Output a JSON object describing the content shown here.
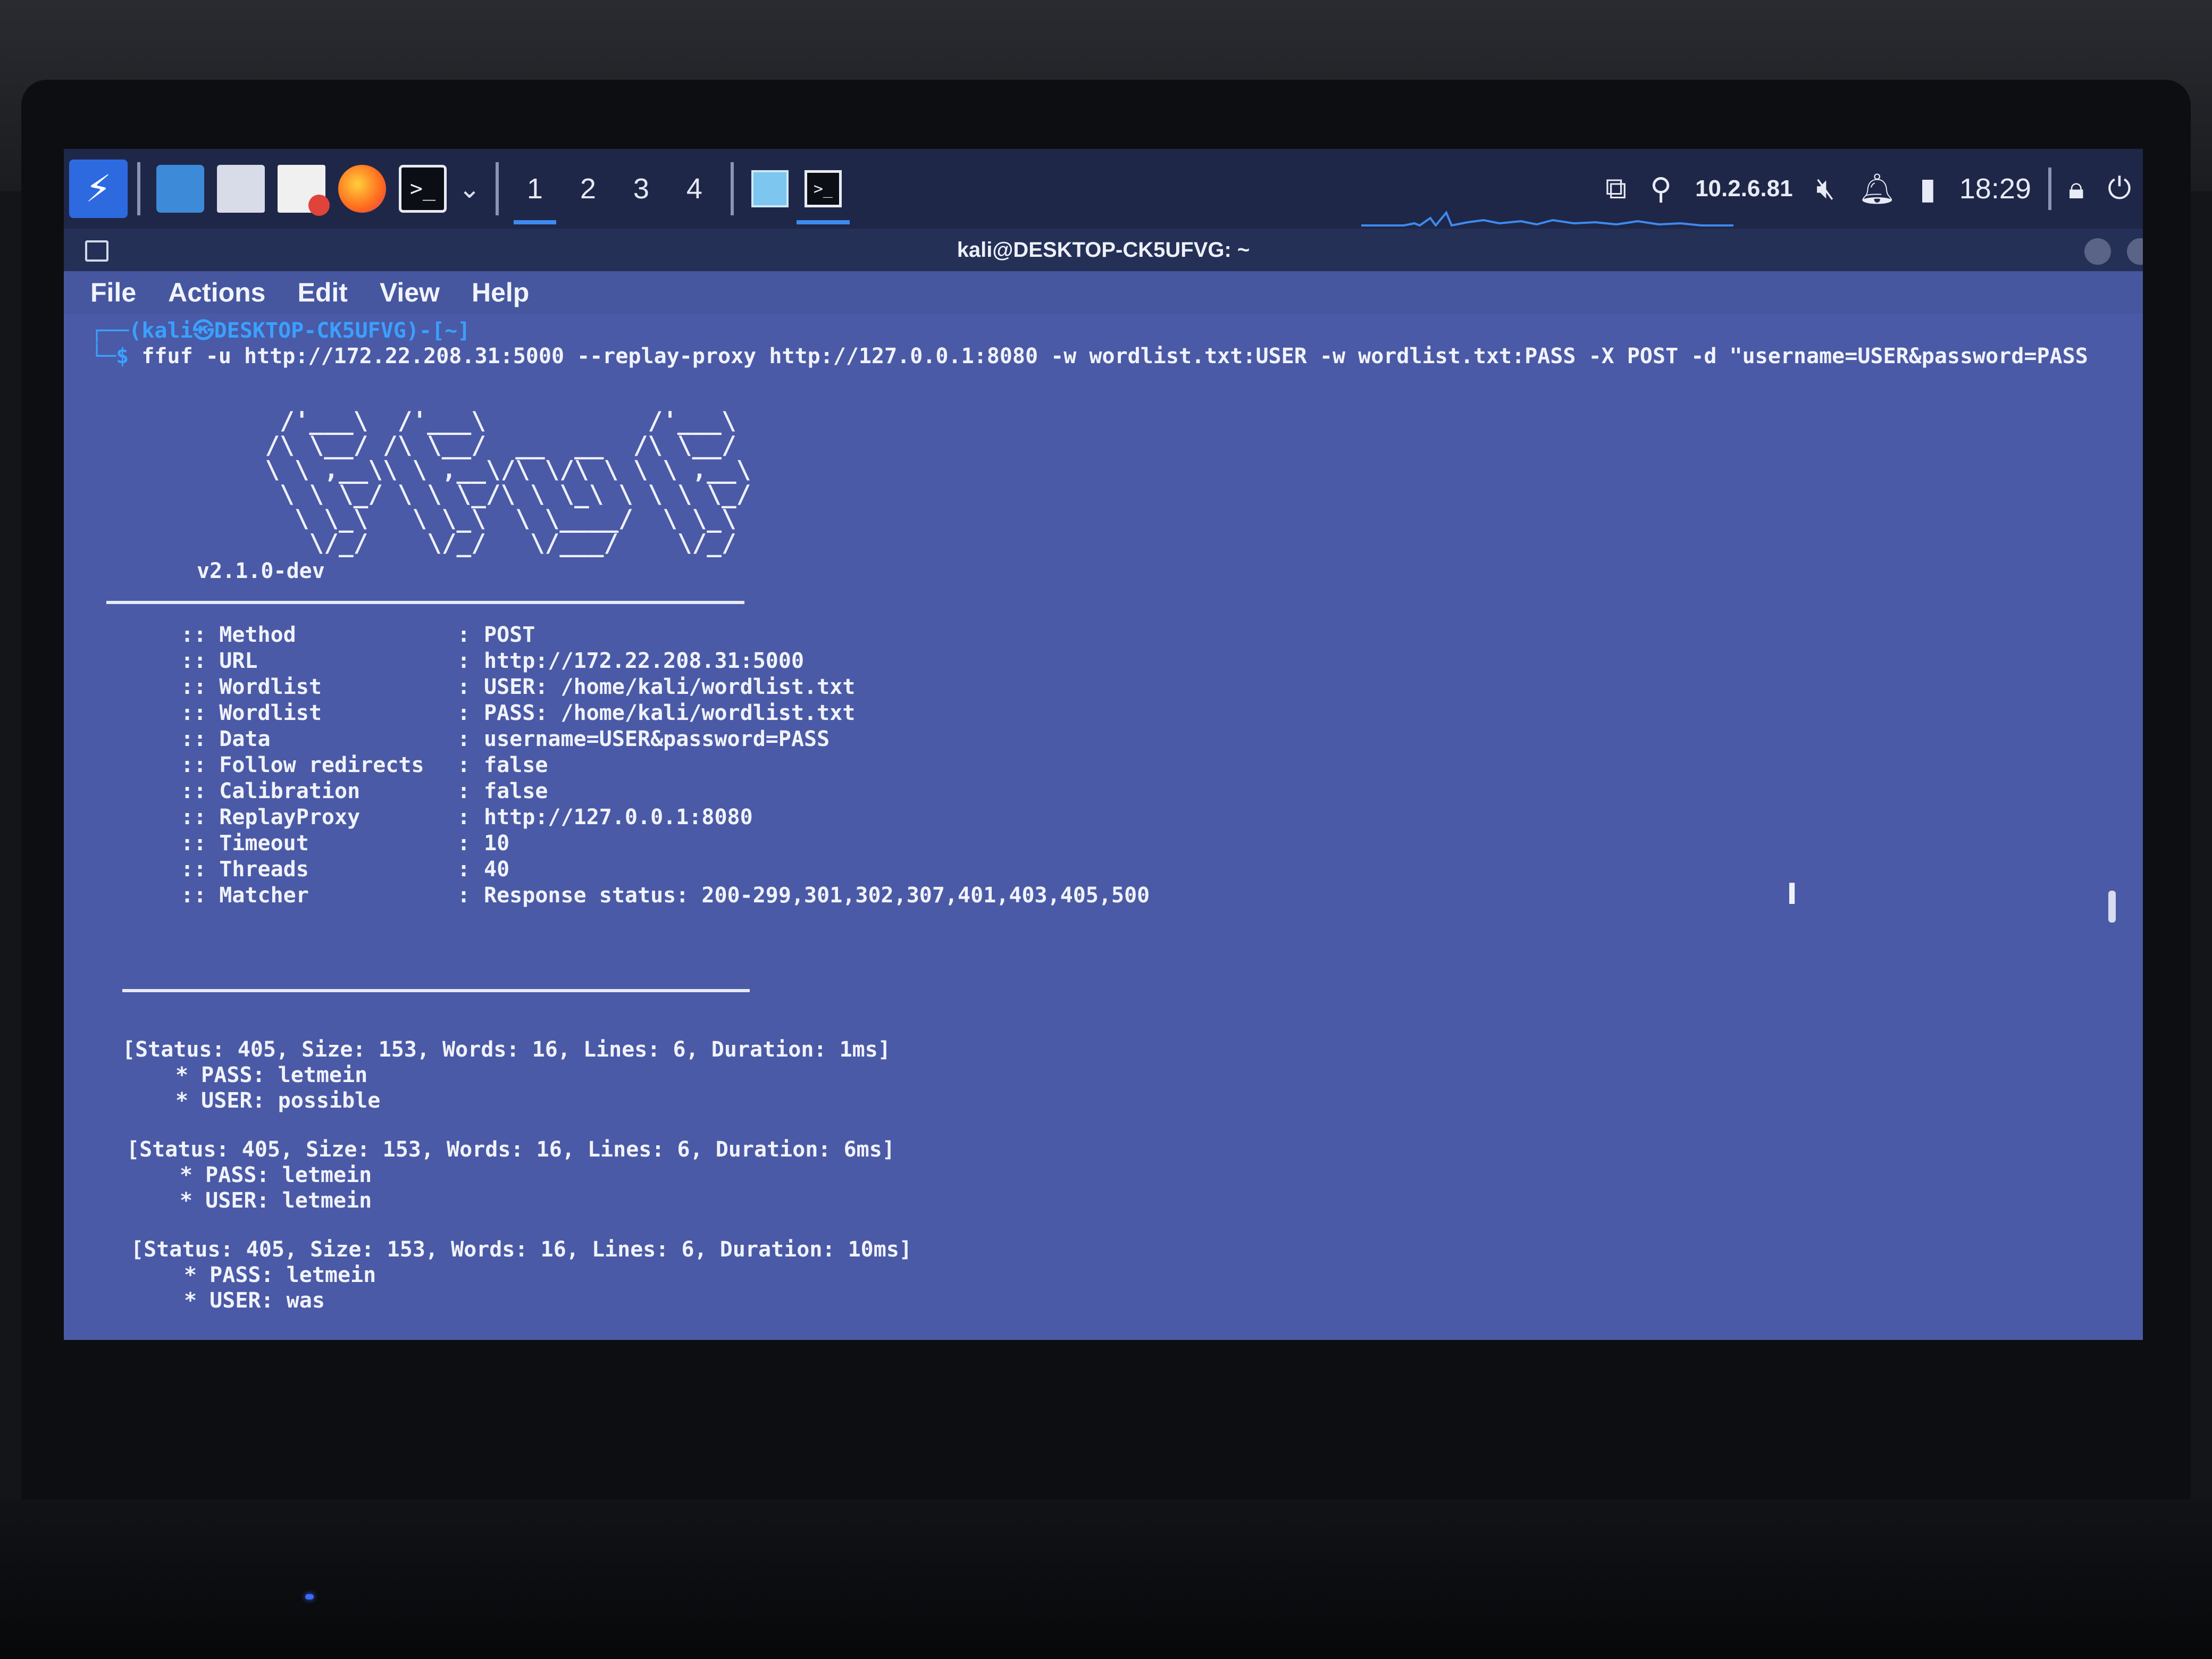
{
  "panel": {
    "workspaces": [
      "1",
      "2",
      "3",
      "4"
    ],
    "active_workspace": "1",
    "ip": "10.2.6.81",
    "clock": "18:29",
    "icons": [
      "kali-menu-icon",
      "show-desktop-icon",
      "file-manager-icon",
      "text-editor-icon",
      "firefox-icon",
      "terminal-launcher-icon",
      "chevron-down-icon",
      "window-list-icon",
      "terminal-window-icon",
      "vpn-icon",
      "network-user-icon",
      "mute-icon",
      "notifications-icon",
      "battery-icon",
      "lock-icon",
      "power-icon"
    ],
    "colors": {
      "panel_bg": "#1f2748",
      "accent": "#3d8af0"
    }
  },
  "window": {
    "title": "kali@DESKTOP-CK5UFVG: ~",
    "menu": [
      "File",
      "Actions",
      "Edit",
      "View",
      "Help"
    ]
  },
  "terminal": {
    "prompt_open": "┌──(",
    "prompt_user": "kali㉿DESKTOP-CK5UFVG",
    "prompt_dir": ")-[~]",
    "prompt_end": "└─$ ",
    "command": "ffuf -u http://172.22.208.31:5000 --replay-proxy http://127.0.0.1:8080 -w wordlist.txt:USER -w wordlist.txt:PASS -X POST -d \"username=USER&password=PASS",
    "banner": "      /'___\\  /'___\\           /'___\\\n     /\\ \\__/ /\\ \\__/  __  __  /\\ \\__/\n     \\ \\ ,__\\\\ \\ ,__\\/\\ \\/\\ \\ \\ \\ ,__\\\n      \\ \\ \\_/ \\ \\ \\_/\\ \\ \\_\\ \\ \\ \\ \\_/\n       \\ \\_\\   \\ \\_\\  \\ \\____/  \\ \\_\\\n        \\/_/    \\/_/   \\/___/    \\/_/",
    "version": "v2.1.0-dev",
    "config": [
      {
        "key": ":: Method",
        "value": "POST"
      },
      {
        "key": ":: URL",
        "value": "http://172.22.208.31:5000"
      },
      {
        "key": ":: Wordlist",
        "value": "USER: /home/kali/wordlist.txt"
      },
      {
        "key": ":: Wordlist",
        "value": "PASS: /home/kali/wordlist.txt"
      },
      {
        "key": ":: Data",
        "value": "username=USER&password=PASS"
      },
      {
        "key": ":: Follow redirects",
        "value": "false"
      },
      {
        "key": ":: Calibration",
        "value": "false"
      },
      {
        "key": ":: ReplayProxy",
        "value": "http://127.0.0.1:8080"
      },
      {
        "key": ":: Timeout",
        "value": "10"
      },
      {
        "key": ":: Threads",
        "value": "40"
      },
      {
        "key": ":: Matcher",
        "value": "Response status: 200-299,301,302,307,401,403,405,500"
      }
    ],
    "results": [
      {
        "status": "[Status: 405, Size: 153, Words: 16, Lines: 6, Duration: 1ms]",
        "pass": "* PASS: letmein",
        "user": "* USER: possible"
      },
      {
        "status": "[Status: 405, Size: 153, Words: 16, Lines: 6, Duration: 6ms]",
        "pass": "* PASS: letmein",
        "user": "* USER: letmein"
      },
      {
        "status": "[Status: 405, Size: 153, Words: 16, Lines: 6, Duration: 10ms]",
        "pass": "* PASS: letmein",
        "user": "* USER: was"
      }
    ]
  }
}
